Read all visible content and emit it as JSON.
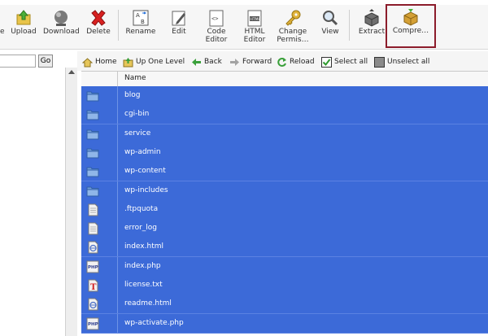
{
  "toolbar": {
    "buttons": [
      {
        "label": "e"
      },
      {
        "label": "Upload"
      },
      {
        "label": "Download"
      },
      {
        "label": "Delete"
      },
      {
        "label": "Rename"
      },
      {
        "label": "Edit"
      },
      {
        "label": "Code Editor"
      },
      {
        "label": "HTML Editor"
      },
      {
        "label": "Change Permis…"
      },
      {
        "label": "View"
      },
      {
        "label": "Extract"
      },
      {
        "label": "Compre…"
      }
    ]
  },
  "left": {
    "go_label": "Go",
    "search_value": ""
  },
  "nav": {
    "home": "Home",
    "up_one_level": "Up One Level",
    "back": "Back",
    "forward": "Forward",
    "reload": "Reload",
    "select_all": "Select all",
    "unselect_all": "Unselect all"
  },
  "table": {
    "header_name": "Name",
    "rows": [
      {
        "name": "blog",
        "icon": "folder-icon"
      },
      {
        "name": "cgi-bin",
        "icon": "folder-icon"
      },
      {
        "name": "service",
        "icon": "folder-icon"
      },
      {
        "name": "wp-admin",
        "icon": "folder-icon"
      },
      {
        "name": "wp-content",
        "icon": "folder-icon"
      },
      {
        "name": "wp-includes",
        "icon": "folder-icon"
      },
      {
        "name": ".ftpquota",
        "icon": "text-file-icon"
      },
      {
        "name": "error_log",
        "icon": "text-file-icon"
      },
      {
        "name": "index.html",
        "icon": "html-file-icon"
      },
      {
        "name": "index.php",
        "icon": "php-file-icon"
      },
      {
        "name": "license.txt",
        "icon": "txt-file-icon"
      },
      {
        "name": "readme.html",
        "icon": "html-file-icon"
      },
      {
        "name": "wp-activate.php",
        "icon": "php-file-icon"
      }
    ]
  },
  "colors": {
    "selected_row": "#3c6ad8",
    "highlight_outline": "#8c1c2b"
  }
}
